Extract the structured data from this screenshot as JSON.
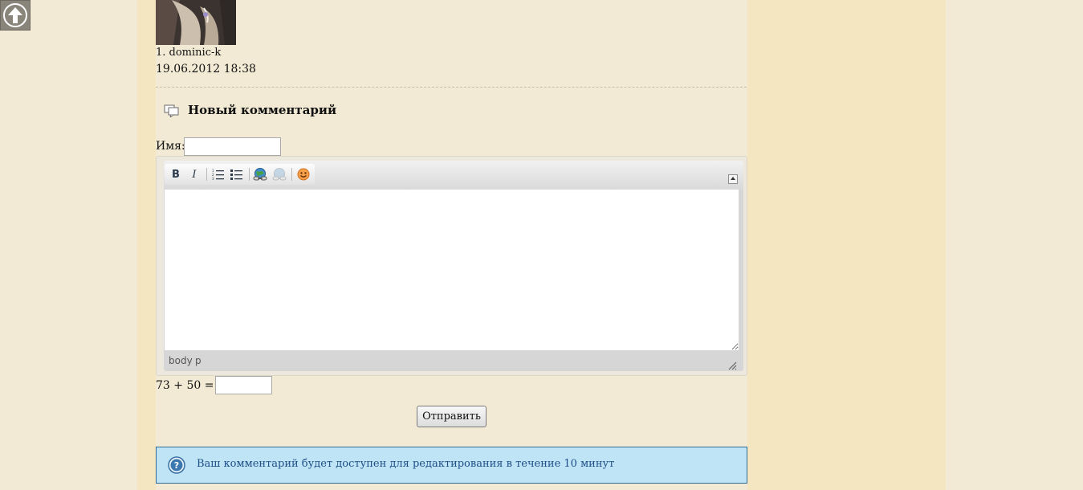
{
  "nav": {
    "scroll_top_icon": "arrow-up-icon"
  },
  "comment": {
    "author": "1. dominic-k",
    "date": "19.06.2012 18:38"
  },
  "form": {
    "title": "Новый комментарий",
    "title_icon": "comments-icon",
    "name_label": "Имя:",
    "name_value": "",
    "editor": {
      "toolbar": [
        {
          "name": "bold",
          "label": "B"
        },
        {
          "name": "italic",
          "label": "I"
        },
        {
          "name": "ordered-list",
          "label": ""
        },
        {
          "name": "unordered-list",
          "label": ""
        },
        {
          "name": "link",
          "label": ""
        },
        {
          "name": "unlink",
          "label": ""
        },
        {
          "name": "emoticons",
          "label": ""
        }
      ],
      "path": [
        "body",
        "p"
      ],
      "content": ""
    },
    "captcha_label": "73 + 50 = ?:",
    "captcha_value": "",
    "submit_label": "Отправить"
  },
  "notice": {
    "icon": "help-icon",
    "text": "Ваш комментарий будет доступен для редактирования в течение 10 минут"
  },
  "colors": {
    "page_bg": "#f2ead4",
    "side_bg": "#f5e6c2",
    "notice_bg": "#bfe4f5",
    "notice_border": "#2e6b96",
    "notice_text": "#1f4f88"
  }
}
